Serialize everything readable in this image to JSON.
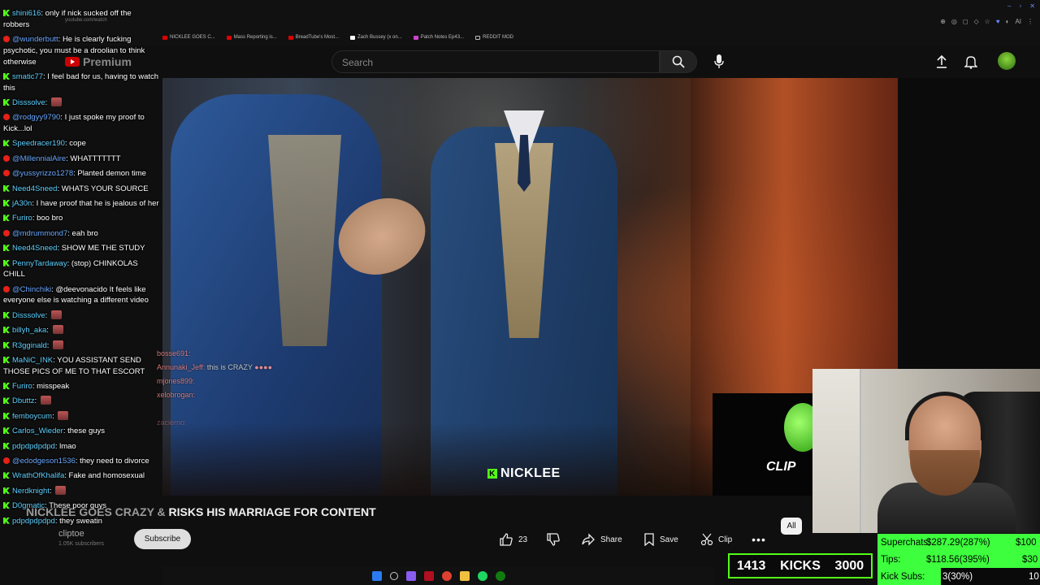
{
  "browser": {
    "url_text": "youtube.com/watch",
    "bookmarks": [
      "NICKLEE GOES C...",
      "Mass Reporting is...",
      "BreadTube's Most...",
      "Zach Bussey (x on...",
      "Patch Notes Ep43...",
      "REDDIT MOD"
    ]
  },
  "youtube": {
    "logo_text": "Premium",
    "search_placeholder": "Search",
    "video_title_faded": "NICKLEE GOES CRAZY &",
    "video_title_main": " RISKS HIS MARRIAGE FOR CONTENT",
    "channel_name": "cliptoe",
    "channel_subs": "1.05K subscribers",
    "subscribe_label": "Subscribe",
    "like_count": "23",
    "share_label": "Share",
    "save_label": "Save",
    "clip_label": "Clip",
    "filter_chip": "All"
  },
  "video": {
    "watermark": "NICKLEE",
    "clip_logo": "CLIP",
    "overlay_chat": [
      {
        "user": "bosse691:",
        "text": ""
      },
      {
        "user": "Annunaki_Jeff:",
        "text": " this is CRAZY"
      },
      {
        "user": "mjones899:",
        "text": ""
      },
      {
        "user": "xelobrogan:",
        "text": ""
      },
      {
        "user": "",
        "text": ""
      },
      {
        "user": "zacierno:",
        "text": ""
      }
    ]
  },
  "chat": [
    {
      "platform": "kick",
      "user": "shini616",
      "text": "only if nick sucked off the robbers"
    },
    {
      "platform": "yt",
      "user": "@wunderbutt",
      "text": "He is clearly fucking psychotic, you must be a droolian to think otherwise"
    },
    {
      "platform": "kick",
      "user": "smatic77",
      "text": "I feel bad for us, having to watch this"
    },
    {
      "platform": "kick",
      "user": "Disssolve",
      "text": "",
      "emote": true
    },
    {
      "platform": "yt",
      "user": "@rodgyy9790",
      "text": "I just spoke my proof to Kick...lol"
    },
    {
      "platform": "kick",
      "user": "Speedracer190",
      "text": "cope"
    },
    {
      "platform": "yt",
      "user": "@MillennialAire",
      "text": "WHATTTTTTT"
    },
    {
      "platform": "yt",
      "user": "@yussyrizzo1278",
      "text": "Planted demon time"
    },
    {
      "platform": "kick",
      "user": "Need4Sneed",
      "text": "WHATS YOUR SOURCE"
    },
    {
      "platform": "kick",
      "user": "jA30n",
      "text": "I have proof that he is jealous of her"
    },
    {
      "platform": "kick",
      "user": "Furiro",
      "text": "boo bro"
    },
    {
      "platform": "yt",
      "user": "@mdrummond7",
      "text": "eah bro"
    },
    {
      "platform": "kick",
      "user": "Need4Sneed",
      "text": "SHOW ME THE STUDY"
    },
    {
      "platform": "kick",
      "user": "PennyTardaway",
      "text": "(stop) CHINKOLAS CHILL"
    },
    {
      "platform": "yt",
      "user": "@Chinchiki",
      "text": "@deevonacido It feels like everyone else is watching a different video"
    },
    {
      "platform": "kick",
      "user": "Disssolve",
      "text": "",
      "emote": true
    },
    {
      "platform": "kick",
      "user": "billyh_aka",
      "text": "",
      "emote": true
    },
    {
      "platform": "kick",
      "user": "R3gginald",
      "text": "",
      "emote": true
    },
    {
      "platform": "kick",
      "user": "MaNiC_INK",
      "text": "YOU ASSISTANT SEND THOSE PICS OF ME TO THAT ESCORT"
    },
    {
      "platform": "kick",
      "user": "Furiro",
      "text": "misspeak"
    },
    {
      "platform": "kick",
      "user": "Dbuttz",
      "text": "",
      "emote": true
    },
    {
      "platform": "kick",
      "user": "femboycum",
      "text": "",
      "emote": true
    },
    {
      "platform": "kick",
      "user": "Carlos_Wieder",
      "text": "these guys"
    },
    {
      "platform": "kick",
      "user": "pdpdpdpdpd",
      "text": "lmao"
    },
    {
      "platform": "yt",
      "user": "@edodgeson1536",
      "text": "they need to divorce"
    },
    {
      "platform": "kick",
      "user": "WrathOfKhalifa",
      "text": "Fake and homosexual"
    },
    {
      "platform": "kick",
      "user": "Nerdknight",
      "text": "",
      "emote": true
    },
    {
      "platform": "kick",
      "user": "D0gmatic",
      "text": "These poor guys"
    },
    {
      "platform": "kick",
      "user": "pdpdpdpdpd",
      "text": "they sweatin"
    }
  ],
  "counters": {
    "kicks_current": "1413",
    "kicks_label": "KICKS",
    "kicks_goal": "3000",
    "superchats_label": "Superchats:",
    "superchats_value": "$287.29(287%)",
    "superchats_goal": "$100",
    "tips_label": "Tips:",
    "tips_value": "$118.56(395%)",
    "tips_goal": "$30",
    "kicksubs_label": "Kick Subs:",
    "kicksubs_value": "3(30%)",
    "kicksubs_goal": "10"
  },
  "colors": {
    "kick_green": "#53fc18",
    "stats_green": "#3dff3d",
    "youtube_red": "#e62117"
  }
}
